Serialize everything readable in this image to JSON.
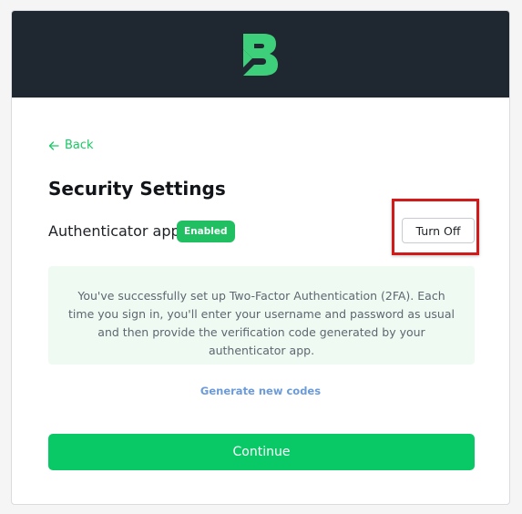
{
  "header": {
    "logo_icon": "brand-b-logo",
    "brand_color": "#3ecf7a",
    "background_color": "#1f2730"
  },
  "nav": {
    "back_label": "Back",
    "back_icon": "arrow-left-icon"
  },
  "page": {
    "title": "Security Settings"
  },
  "authenticator": {
    "label": "Authenticator app",
    "status_badge": "Enabled",
    "status_color": "#1fbf62",
    "turn_off_label": "Turn Off",
    "highlighted": true,
    "highlight_color": "#d11a1a"
  },
  "info": {
    "message": "You've successfully set up Two-Factor Authentication (2FA). Each time you sign in, you'll enter your username and password as usual and then provide the verification code generated by your authenticator app."
  },
  "actions": {
    "generate_codes_label": "Generate new codes",
    "continue_label": "Continue",
    "accent_color": "#08c966"
  }
}
